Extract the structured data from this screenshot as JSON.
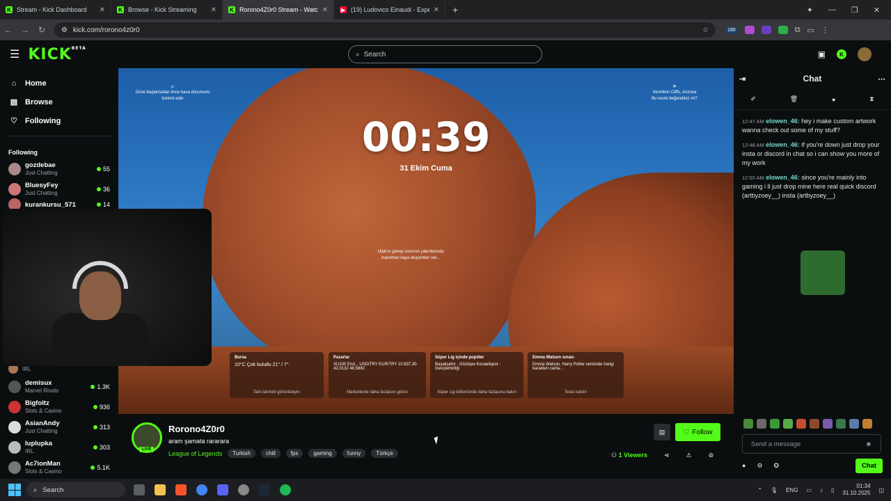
{
  "browser": {
    "tabs": [
      {
        "label": "Stream - Kick Dashboard",
        "icon": "kick-icon"
      },
      {
        "label": "Browse - Kick Streaming",
        "icon": "kick-icon"
      },
      {
        "label": "Rorono4Z0r0 Stream - Watc",
        "icon": "kick-icon",
        "active": true
      },
      {
        "label": "(19) Ludovico Einaudi - Experie",
        "icon": "youtube-icon"
      }
    ],
    "url": "kick.com/rorono4z0r0",
    "ext_badge": "190"
  },
  "header": {
    "logo": "KICK",
    "logo_badge": "BETA",
    "search_placeholder": "Search"
  },
  "sidebar": {
    "nav": [
      {
        "label": "Home",
        "icon": "home-icon"
      },
      {
        "label": "Browse",
        "icon": "browse-icon"
      },
      {
        "label": "Following",
        "icon": "heart-icon"
      }
    ],
    "following_title": "Following",
    "channels": [
      {
        "name": "gozdebae",
        "category": "Just Chatting",
        "viewers": "55",
        "color": "#a88"
      },
      {
        "name": "BluesyFey",
        "category": "Just Chatting",
        "viewers": "36",
        "color": "#c77"
      },
      {
        "name": "kurankursu_571",
        "category": "",
        "viewers": "14",
        "color": "#b66"
      },
      {
        "name": "",
        "category": "IRL",
        "viewers": "",
        "color": "#a75"
      },
      {
        "name": "demisux",
        "category": "Marvel Rivals",
        "viewers": "1.3K",
        "color": "#555"
      },
      {
        "name": "Bigfoltz",
        "category": "Slots & Casino",
        "viewers": "936",
        "color": "#c33"
      },
      {
        "name": "AsianAndy",
        "category": "Just Chatting",
        "viewers": "313",
        "color": "#ddd"
      },
      {
        "name": "luplupka",
        "category": "IRL",
        "viewers": "303",
        "color": "#bbb"
      },
      {
        "name": "Ac7ionMan",
        "category": "Slots & Casino",
        "viewers": "5.1K",
        "color": "#777"
      }
    ]
  },
  "video": {
    "clock": "00:39",
    "date": "31 Ekim Cuma",
    "weather_hint": "Güne başlamadan önce hava durumunu kontrol edin",
    "location": "Vermilion Cliffs, Arizona",
    "location_q": "Bu resmi beğendiniz mi?",
    "mid_text": "Utah'ın güney sınırının yakınlarında inanılmaz kaya oluşumları var...",
    "cards": [
      {
        "title": "Bursa",
        "body": "10°C  Çok bulutlu 21° / 7°",
        "foot": "Tam tahmini görüntüleyin"
      },
      {
        "title": "Pazarlar",
        "body": "XU100 End... USD/TRY EUR/TRY  10.837,30  42,0132  48,5882",
        "foot": "Marketlerde daha fazlasını görün"
      },
      {
        "title": "Süper Lig içinde popüler",
        "body": "Başakşehir - Göztepe  Kocaelispor - Gençlerbirliği",
        "foot": "Süper Lig bölümünde daha fazlasına bakın"
      },
      {
        "title": "Emma Watson sınavı",
        "body": "Emma Watson, Harry Potter serisinde hangi karakteri canla...",
        "foot": "Teste katılın"
      }
    ]
  },
  "stream": {
    "name": "Rorono4Z0r0",
    "title": "aram şamata rararara",
    "live": "LIVE",
    "category": "League of Legends",
    "tags": [
      "Turkish",
      "chill",
      "fps",
      "gaming",
      "funny",
      "Türkçe"
    ],
    "follow": "Follow",
    "viewers_num": "1",
    "viewers_label": "Viewers"
  },
  "chat": {
    "title": "Chat",
    "messages": [
      {
        "time": "12:47 AM",
        "user": "elowen_46:",
        "text": "hey i make custom artwork wanna check out some of my stuff?"
      },
      {
        "time": "12:48 AM",
        "user": "elowen_46:",
        "text": "if you're down just drop your insta or discord in chat so i can show you more of my work"
      },
      {
        "time": "12:50 AM",
        "user": "elowen_46:",
        "text": "since you're mainly into gaming i ll just drop mine here real quick discord (artbyzoey__) insta (artbyzoey__)"
      }
    ],
    "placeholder": "Send a message",
    "send_label": "Chat"
  },
  "taskbar": {
    "search": "Search",
    "lang": "ENG",
    "time": "01:34",
    "date": "31.10.2025"
  },
  "colors": {
    "accent": "#53fc18",
    "bg": "#0b0e0f",
    "username": "#78d8c8"
  }
}
